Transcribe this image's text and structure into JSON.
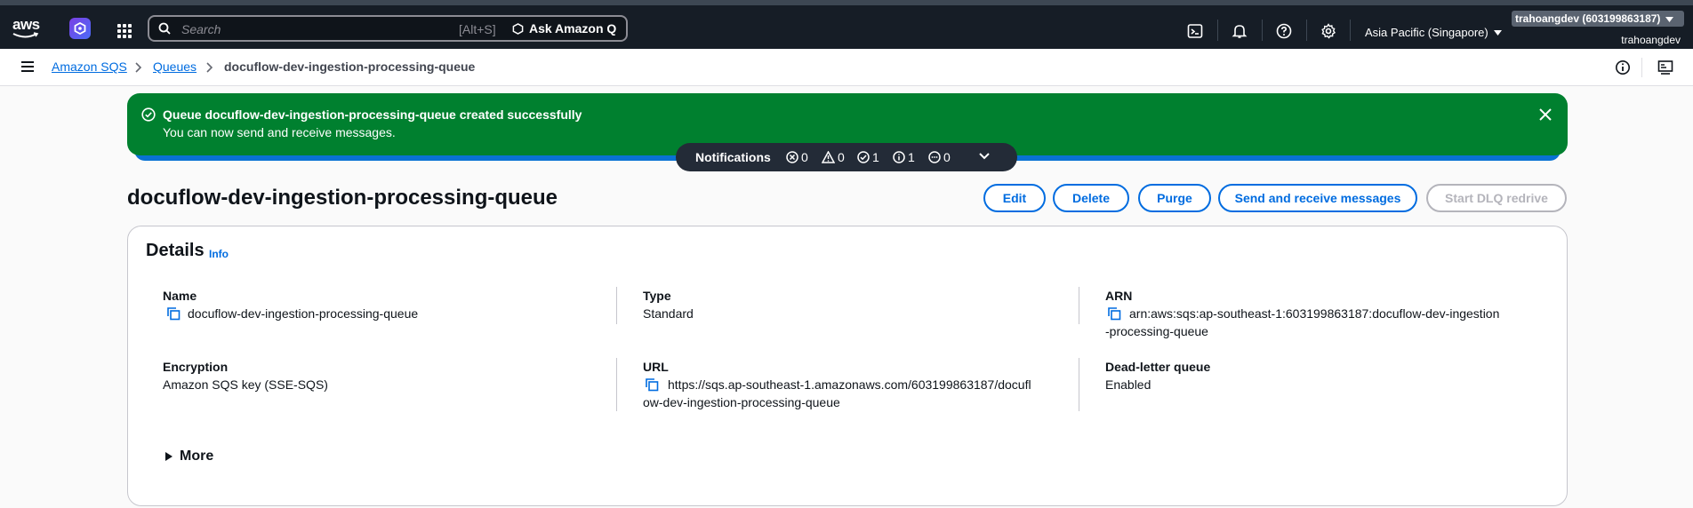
{
  "topnav": {
    "logo_text": "aws",
    "search_placeholder": "Search",
    "search_shortcut": "[Alt+S]",
    "ask_q_label": "Ask Amazon Q",
    "region": "Asia Pacific (Singapore)",
    "account": "trahoangdev (603199863187)",
    "username": "trahoangdev"
  },
  "breadcrumb": {
    "items": [
      "Amazon SQS",
      "Queues",
      "docuflow-dev-ingestion-processing-queue"
    ]
  },
  "flash": {
    "title": "Queue docuflow-dev-ingestion-processing-queue created successfully",
    "message": "You can now send and receive messages."
  },
  "notifications": {
    "label": "Notifications",
    "errors": "0",
    "warnings": "0",
    "success": "1",
    "info": "1",
    "in_progress": "0"
  },
  "header": {
    "title": "docuflow-dev-ingestion-processing-queue",
    "buttons": {
      "edit": "Edit",
      "delete": "Delete",
      "purge": "Purge",
      "send_receive": "Send and receive messages",
      "start_dlq": "Start DLQ redrive"
    }
  },
  "details": {
    "title": "Details",
    "info": "Info",
    "name_label": "Name",
    "name_value": "docuflow-dev-ingestion-processing-queue",
    "type_label": "Type",
    "type_value": "Standard",
    "arn_label": "ARN",
    "arn_value_line1": "arn:aws:sqs:ap-southeast-1:603199863187:docuflow-dev-ingestion",
    "arn_value_line2": "-processing-queue",
    "encryption_label": "Encryption",
    "encryption_value": "Amazon SQS key (SSE-SQS)",
    "url_label": "URL",
    "url_value_line1": "https://sqs.ap-southeast-1.amazonaws.com/603199863187/docufl",
    "url_value_line2": "ow-dev-ingestion-processing-queue",
    "dlq_label": "Dead-letter queue",
    "dlq_value": "Enabled",
    "more": "More"
  },
  "colors": {
    "nav_bg": "#161d26",
    "success": "#00802f",
    "link": "#006ce0"
  }
}
